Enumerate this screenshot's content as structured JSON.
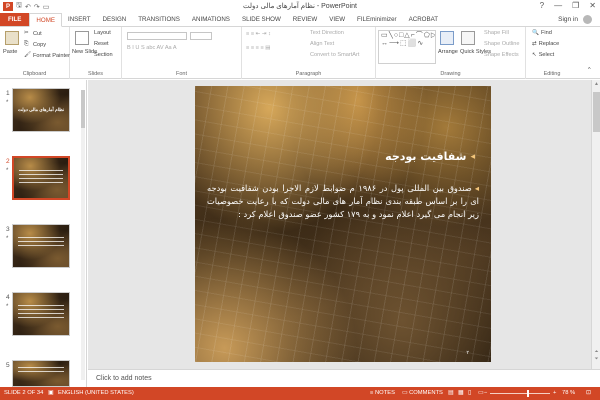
{
  "app": {
    "window_title": "نظام آمارهای مالی دولت - PowerPoint",
    "icon_label": "P"
  },
  "window_controls": [
    "?",
    "—",
    "❐",
    "✕"
  ],
  "ribbon_tabs": [
    "FILE",
    "HOME",
    "INSERT",
    "DESIGN",
    "TRANSITIONS",
    "ANIMATIONS",
    "SLIDE SHOW",
    "REVIEW",
    "VIEW",
    "FILEminimizer",
    "ACROBAT"
  ],
  "active_tab": "HOME",
  "account": {
    "sign_in": "Sign in"
  },
  "ribbon": {
    "clipboard": {
      "paste": "Paste",
      "cut": "Cut",
      "copy": "Copy",
      "format_painter": "Format Painter",
      "label": "Clipboard"
    },
    "slides": {
      "new_slide": "New Slide",
      "layout": "Layout",
      "reset": "Reset",
      "section": "Section",
      "label": "Slides"
    },
    "font": {
      "label": "Font"
    },
    "paragraph": {
      "text_direction": "Text Direction",
      "align_text": "Align Text",
      "convert_smartart": "Convert to SmartArt",
      "label": "Paragraph"
    },
    "drawing": {
      "arrange": "Arrange",
      "quick_styles": "Quick Styles",
      "shape_fill": "Shape Fill",
      "shape_outline": "Shape Outline",
      "shape_effects": "Shape Effects",
      "label": "Drawing"
    },
    "editing": {
      "find": "Find",
      "replace": "Replace",
      "select": "Select",
      "label": "Editing"
    }
  },
  "thumbnails": [
    {
      "number": "1",
      "title": "نظام آمارهای مالی دولت",
      "selected": false,
      "star": "*"
    },
    {
      "number": "2",
      "title": "",
      "selected": true,
      "star": "*"
    },
    {
      "number": "3",
      "title": "",
      "selected": false,
      "star": "*"
    },
    {
      "number": "4",
      "title": "",
      "selected": false,
      "star": "*"
    },
    {
      "number": "5",
      "title": "",
      "selected": false,
      "star": ""
    }
  ],
  "slide": {
    "title": "شفافیت بودجه",
    "body": "صندوق بین المللی پول در ۱۹۸۶ م ضوابط لازم الاجرا بودن شفافیت بودجه ای را بر اساس طبقه بندی نظام آمار های مالی دولت که با رعایت خصوصیات زیر انجام می گیرد اعلام نمود و به ۱۷۹ کشور عضو صندوق اعلام کرد :",
    "page_number": "۲"
  },
  "notes": {
    "placeholder": "Click to add notes"
  },
  "status_bar": {
    "slide_info": "SLIDE 2 OF 34",
    "language": "ENGLISH (UNITED STATES)",
    "notes": "NOTES",
    "comments": "COMMENTS",
    "zoom": "78 %"
  },
  "colors": {
    "accent": "#d24726",
    "slide_text": "#ffffff",
    "bullet": "#f3c57a"
  }
}
